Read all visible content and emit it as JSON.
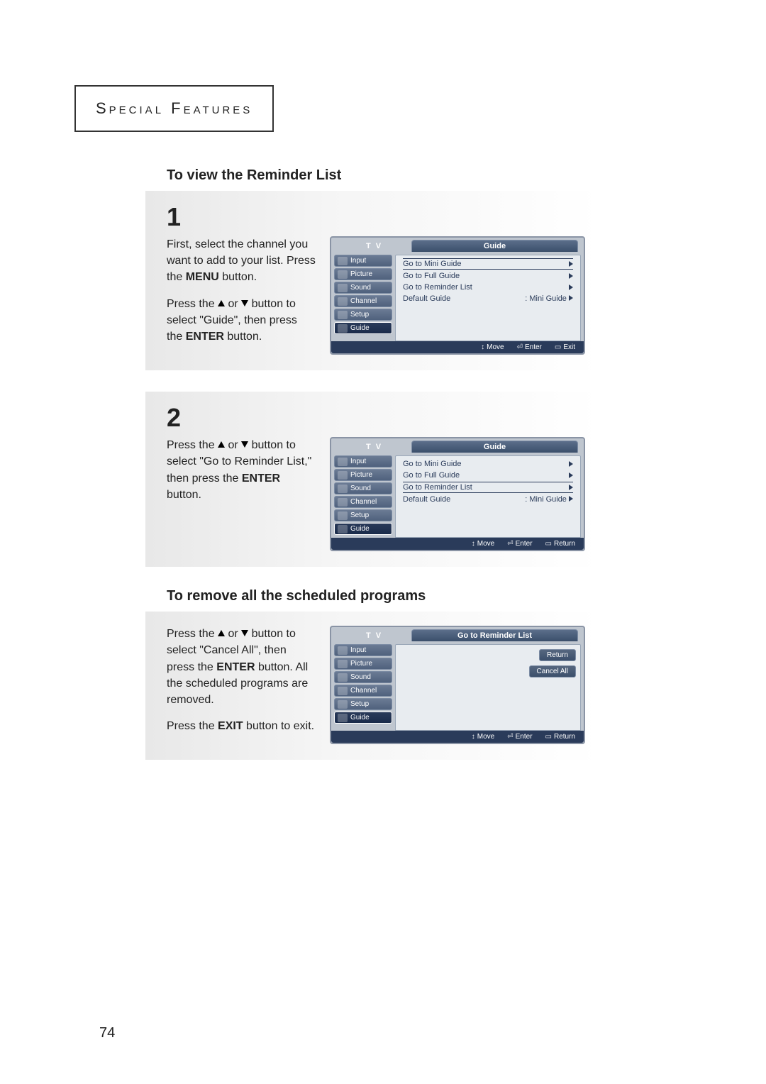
{
  "header": "Special Features",
  "heading1": "To view the Reminder List",
  "heading2": "To remove all the scheduled programs",
  "step1": {
    "num": "1",
    "p1a": "First, select the channel you want to add to your list. Press the ",
    "p1b": "MENU",
    "p1c": " button.",
    "p2a": "Press the ",
    "p2b": " or ",
    "p2c": " button to select \"Guide\", then press the ",
    "p2d": "ENTER",
    "p2e": " button."
  },
  "step2": {
    "num": "2",
    "p1a": "Press the ",
    "p1b": " or ",
    "p1c": " button to select \"Go to Reminder List,\" then press the ",
    "p1d": "ENTER",
    "p1e": " button."
  },
  "step3": {
    "p1a": "Press the ",
    "p1b": " or ",
    "p1c": " button to select \"Cancel All\", then press the ",
    "p1d": "ENTER",
    "p1e": " button. All the scheduled programs are removed.",
    "p2a": "Press the ",
    "p2b": "EXIT",
    "p2c": " button to exit."
  },
  "osd": {
    "tv": "T V",
    "title_guide": "Guide",
    "title_reminder": "Go to Reminder List",
    "menu": [
      "Input",
      "Picture",
      "Sound",
      "Channel",
      "Setup",
      "Guide"
    ],
    "rows": {
      "mini": "Go to Mini Guide",
      "full": "Go to Full Guide",
      "rem": "Go to Reminder List",
      "defg": "Default Guide",
      "defg_val": ": Mini Guide"
    },
    "btn_return": "Return",
    "btn_cancel": "Cancel All",
    "foot": {
      "move": "Move",
      "enter": "Enter",
      "exit": "Exit",
      "return": "Return"
    }
  },
  "page": "74"
}
